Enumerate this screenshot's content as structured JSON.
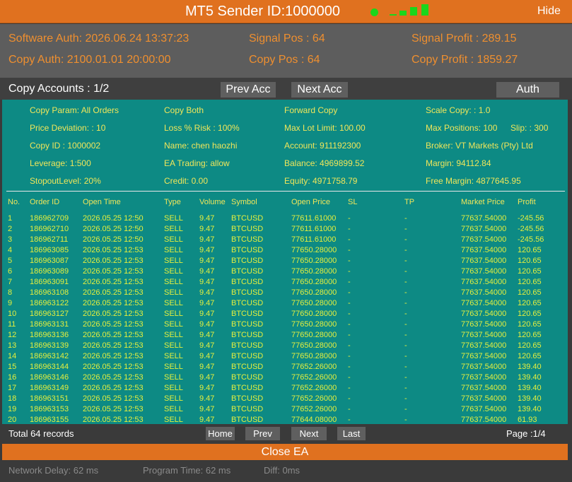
{
  "title": "MT5 Sender ID:1000000",
  "hide_label": "Hide",
  "info": {
    "software_auth": "Software Auth: 2026.06.24 13:37:23",
    "copy_auth": "Copy Auth: 2100.01.01 20:00:00",
    "signal_pos": "Signal Pos : 64",
    "copy_pos": "Copy Pos : 64",
    "signal_profit": "Signal Profit : 289.15",
    "copy_profit": "Copy Profit : 1859.27"
  },
  "accounts": {
    "title": "Copy Accounts : 1/2",
    "prev_label": "Prev Acc",
    "next_label": "Next Acc",
    "auth_label": "Auth"
  },
  "params": {
    "copy_param": "Copy Param: All Orders",
    "copy_both": "Copy Both",
    "forward_copy": "Forward Copy",
    "scale_copy": "Scale Copy: :  1.0",
    "price_deviation": "Price Deviation: :  10",
    "loss_risk": "Loss % Risk :  100%",
    "max_lot": "Max Lot Limit: 100.00",
    "max_positions": "Max Positions: 100",
    "slip": "Slip: :  300",
    "copy_id": "Copy ID : 1000002",
    "name": "Name: chen haozhi",
    "account": "Account: 911192300",
    "broker": "Broker: VT Markets (Pty) Ltd",
    "leverage": "Leverage: 1:500",
    "ea_trading": "EA Trading: allow",
    "balance": "Balance: 4969899.52",
    "margin": "Margin: 94112.84",
    "stopout": "StopoutLevel: 20%",
    "credit": "Credit: 0.00",
    "equity": "Equity: 4971758.79",
    "free_margin": "Free Margin: 4877645.95"
  },
  "table": {
    "columns": [
      "No.",
      "Order ID",
      "Open Time",
      "Type",
      "Volume",
      "Symbol",
      "Open Price",
      "SL",
      "TP",
      "Market Price",
      "Profit"
    ],
    "rows": [
      [
        "1",
        "186962709",
        "2026.05.25 12:50",
        "SELL",
        "9.47",
        "BTCUSD",
        "77611.61000",
        "-",
        "-",
        "77637.54000",
        "-245.56"
      ],
      [
        "2",
        "186962710",
        "2026.05.25 12:50",
        "SELL",
        "9.47",
        "BTCUSD",
        "77611.61000",
        "-",
        "-",
        "77637.54000",
        "-245.56"
      ],
      [
        "3",
        "186962711",
        "2026.05.25 12:50",
        "SELL",
        "9.47",
        "BTCUSD",
        "77611.61000",
        "-",
        "-",
        "77637.54000",
        "-245.56"
      ],
      [
        "4",
        "186963085",
        "2026.05.25 12:53",
        "SELL",
        "9.47",
        "BTCUSD",
        "77650.28000",
        "-",
        "-",
        "77637.54000",
        "120.65"
      ],
      [
        "5",
        "186963087",
        "2026.05.25 12:53",
        "SELL",
        "9.47",
        "BTCUSD",
        "77650.28000",
        "-",
        "-",
        "77637.54000",
        "120.65"
      ],
      [
        "6",
        "186963089",
        "2026.05.25 12:53",
        "SELL",
        "9.47",
        "BTCUSD",
        "77650.28000",
        "-",
        "-",
        "77637.54000",
        "120.65"
      ],
      [
        "7",
        "186963091",
        "2026.05.25 12:53",
        "SELL",
        "9.47",
        "BTCUSD",
        "77650.28000",
        "-",
        "-",
        "77637.54000",
        "120.65"
      ],
      [
        "8",
        "186963108",
        "2026.05.25 12:53",
        "SELL",
        "9.47",
        "BTCUSD",
        "77650.28000",
        "-",
        "-",
        "77637.54000",
        "120.65"
      ],
      [
        "9",
        "186963122",
        "2026.05.25 12:53",
        "SELL",
        "9.47",
        "BTCUSD",
        "77650.28000",
        "-",
        "-",
        "77637.54000",
        "120.65"
      ],
      [
        "10",
        "186963127",
        "2026.05.25 12:53",
        "SELL",
        "9.47",
        "BTCUSD",
        "77650.28000",
        "-",
        "-",
        "77637.54000",
        "120.65"
      ],
      [
        "11",
        "186963131",
        "2026.05.25 12:53",
        "SELL",
        "9.47",
        "BTCUSD",
        "77650.28000",
        "-",
        "-",
        "77637.54000",
        "120.65"
      ],
      [
        "12",
        "186963136",
        "2026.05.25 12:53",
        "SELL",
        "9.47",
        "BTCUSD",
        "77650.28000",
        "-",
        "-",
        "77637.54000",
        "120.65"
      ],
      [
        "13",
        "186963139",
        "2026.05.25 12:53",
        "SELL",
        "9.47",
        "BTCUSD",
        "77650.28000",
        "-",
        "-",
        "77637.54000",
        "120.65"
      ],
      [
        "14",
        "186963142",
        "2026.05.25 12:53",
        "SELL",
        "9.47",
        "BTCUSD",
        "77650.28000",
        "-",
        "-",
        "77637.54000",
        "120.65"
      ],
      [
        "15",
        "186963144",
        "2026.05.25 12:53",
        "SELL",
        "9.47",
        "BTCUSD",
        "77652.26000",
        "-",
        "-",
        "77637.54000",
        "139.40"
      ],
      [
        "16",
        "186963146",
        "2026.05.25 12:53",
        "SELL",
        "9.47",
        "BTCUSD",
        "77652.26000",
        "-",
        "-",
        "77637.54000",
        "139.40"
      ],
      [
        "17",
        "186963149",
        "2026.05.25 12:53",
        "SELL",
        "9.47",
        "BTCUSD",
        "77652.26000",
        "-",
        "-",
        "77637.54000",
        "139.40"
      ],
      [
        "18",
        "186963151",
        "2026.05.25 12:53",
        "SELL",
        "9.47",
        "BTCUSD",
        "77652.26000",
        "-",
        "-",
        "77637.54000",
        "139.40"
      ],
      [
        "19",
        "186963153",
        "2026.05.25 12:53",
        "SELL",
        "9.47",
        "BTCUSD",
        "77652.26000",
        "-",
        "-",
        "77637.54000",
        "139.40"
      ],
      [
        "20",
        "186963155",
        "2026.05.25 12:53",
        "SELL",
        "9.47",
        "BTCUSD",
        "77644.08000",
        "-",
        "-",
        "77637.54000",
        "61.93"
      ]
    ]
  },
  "pagination": {
    "total": "Total 64 records",
    "home_label": "Home",
    "prev_label": "Prev",
    "next_label": "Next",
    "last_label": "Last",
    "page_info": "Page :1/4"
  },
  "close_label": "Close EA",
  "status": {
    "network_delay": "Network Delay:  62 ms",
    "program_time": "Program Time:  62 ms",
    "diff": "Diff:  0ms"
  },
  "colors": {
    "accent": "#e0711f",
    "panel": "#0d8a84",
    "highlight": "#f0e65a",
    "status_ok": "#1bd61b"
  }
}
